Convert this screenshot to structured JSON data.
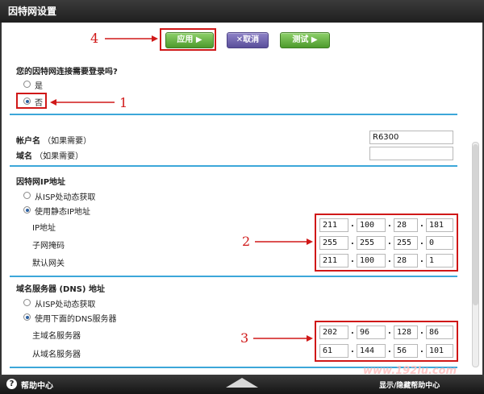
{
  "window": {
    "title": "因特网设置"
  },
  "toolbar": {
    "apply_label": "应用 ▶",
    "cancel_label": "✕取消",
    "test_label": "测试 ▶"
  },
  "login_question": {
    "label": "您的因特网连接需要登录吗?",
    "options": [
      {
        "label": "是",
        "checked": false
      },
      {
        "label": "否",
        "checked": true
      }
    ]
  },
  "account": {
    "name_label": "帐户名",
    "name_hint": "（如果需要）",
    "name_value": "R6300",
    "domain_label": "域名",
    "domain_hint": "（如果需要）",
    "domain_value": ""
  },
  "ip_section": {
    "title": "因特网IP地址",
    "options": [
      {
        "label": "从ISP处动态获取",
        "checked": false
      },
      {
        "label": "使用静态IP地址",
        "checked": true
      }
    ],
    "ip_label": "IP地址",
    "ip": [
      "211",
      "100",
      "28",
      "181"
    ],
    "mask_label": "子网掩码",
    "mask": [
      "255",
      "255",
      "255",
      "0"
    ],
    "gateway_label": "默认网关",
    "gateway": [
      "211",
      "100",
      "28",
      "1"
    ]
  },
  "dns_section": {
    "title": "域名服务器 (DNS) 地址",
    "options": [
      {
        "label": "从ISP处动态获取",
        "checked": false
      },
      {
        "label": "使用下面的DNS服务器",
        "checked": true
      }
    ],
    "primary_label": "主域名服务器",
    "primary": [
      "202",
      "96",
      "128",
      "86"
    ],
    "secondary_label": "从域名服务器",
    "secondary": [
      "61",
      "144",
      "56",
      "101"
    ]
  },
  "annotations": {
    "one": "1",
    "two": "2",
    "three": "3",
    "four": "4"
  },
  "footer": {
    "help_label": "帮助中心",
    "show_help_label": "显示/隐藏帮助中心",
    "watermark": "www.192lu.com"
  },
  "colors": {
    "accent_line": "#3ca7d9",
    "annotation_red": "#d01818",
    "apply_green": "#5fae3a",
    "cancel_purple": "#6a5fb0"
  }
}
